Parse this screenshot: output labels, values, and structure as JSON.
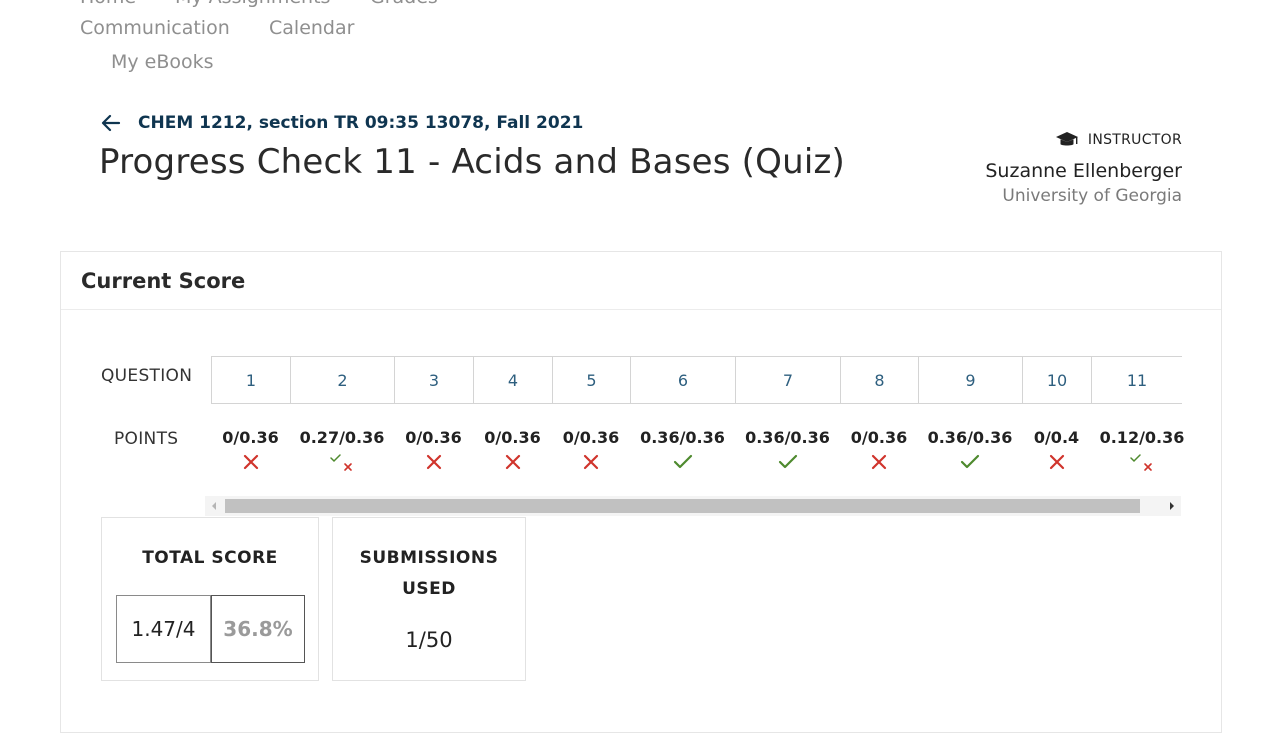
{
  "nav": {
    "home": "Home",
    "my_assignments": "My Assignments",
    "grades": "Grades",
    "communication": "Communication",
    "calendar": "Calendar",
    "my_ebooks": "My eBooks"
  },
  "header": {
    "course": "CHEM 1212, section TR 09:35 13078, Fall 2021",
    "title": "Progress Check 11 - Acids and Bases (Quiz)",
    "instructor_label": "INSTRUCTOR",
    "instructor_name": "Suzanne Ellenberger",
    "institution": "University of Georgia",
    "icons": {
      "back": "arrow-left-icon",
      "instructor": "graduation-cap-icon"
    }
  },
  "card": {
    "title": "Current Score",
    "question_label": "QUESTION",
    "points_label": "POINTS",
    "questions": [
      {
        "number": "1",
        "points": "0/0.36",
        "status": "incorrect"
      },
      {
        "number": "2",
        "points": "0.27/0.36",
        "status": "partial"
      },
      {
        "number": "3",
        "points": "0/0.36",
        "status": "incorrect"
      },
      {
        "number": "4",
        "points": "0/0.36",
        "status": "incorrect"
      },
      {
        "number": "5",
        "points": "0/0.36",
        "status": "incorrect"
      },
      {
        "number": "6",
        "points": "0.36/0.36",
        "status": "correct"
      },
      {
        "number": "7",
        "points": "0.36/0.36",
        "status": "correct"
      },
      {
        "number": "8",
        "points": "0/0.36",
        "status": "incorrect"
      },
      {
        "number": "9",
        "points": "0.36/0.36",
        "status": "correct"
      },
      {
        "number": "10",
        "points": "0/0.4",
        "status": "incorrect"
      },
      {
        "number": "11",
        "points": "0.12/0.36",
        "status": "partial"
      }
    ],
    "total_score": {
      "title": "TOTAL SCORE",
      "fraction": "1.47/4",
      "percent": "36.8%"
    },
    "submissions": {
      "title_line1": "SUBMISSIONS",
      "title_line2": "USED",
      "value": "1/50"
    }
  },
  "colors": {
    "incorrect": "#d0342c",
    "correct": "#4e8a2e",
    "link": "#0f3550",
    "question_number": "#2e5f7f"
  }
}
